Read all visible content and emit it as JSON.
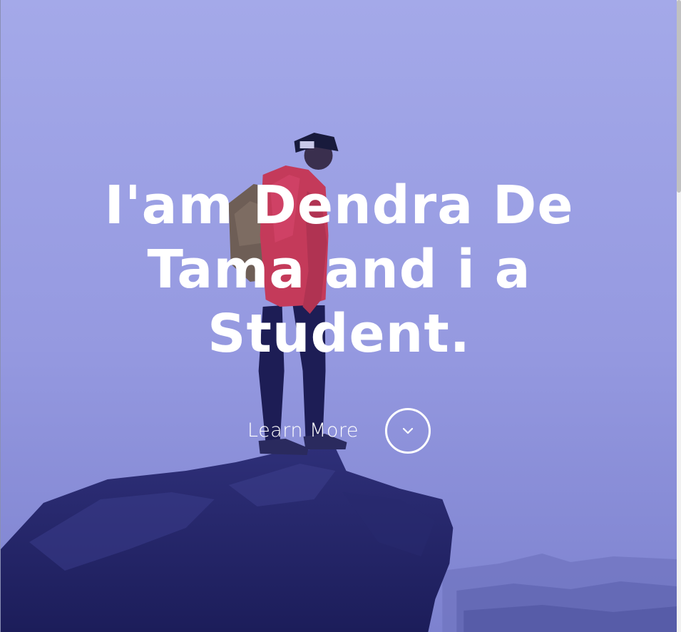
{
  "hero": {
    "title": "I'am Dendra De Tama and i a Student.",
    "cta_label": "Learn More",
    "cta_icon": "chevron-down-icon",
    "overlay_color": "#8f94e4",
    "text_color": "#ffffff"
  }
}
